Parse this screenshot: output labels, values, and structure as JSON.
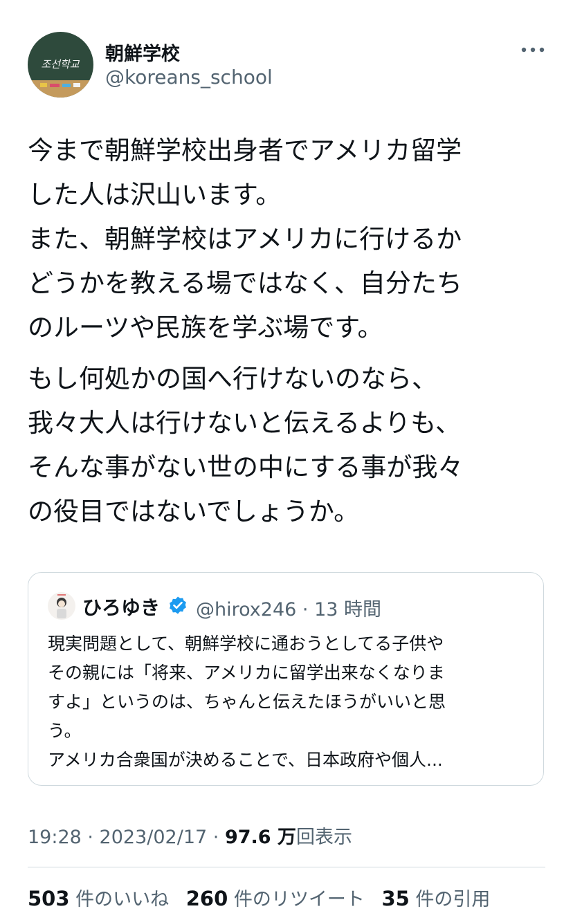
{
  "author": {
    "display_name": "朝鮮学校",
    "handle": "@koreans_school",
    "avatar_text": "조선학교"
  },
  "tweet": {
    "paragraphs": [
      [
        "今まで朝鮮学校出身者でアメリカ留学",
        "した人は沢山います。",
        "また、朝鮮学校はアメリカに行けるか",
        "どうかを教える場ではなく、自分たち",
        "のルーツや民族を学ぶ場です。"
      ],
      [
        "もし何処かの国へ行けないのなら、",
        "我々大人は行けないと伝えるよりも、",
        "そんな事がない世の中にする事が我々",
        "の役目ではないでしょうか。"
      ]
    ]
  },
  "quote": {
    "name": "ひろゆき",
    "handle_time": "@hirox246 · 13 時間",
    "lines": [
      "現実問題として、朝鮮学校に通おうとしてる子供や",
      "その親には「将来、アメリカに留学出来なくなりま",
      "すよ」というのは、ちゃんと伝えたほうがいいと思",
      "う。",
      "アメリカ合衆国が決めることで、日本政府や個人..."
    ]
  },
  "meta": {
    "time": "19:28 · 2023/02/17 · ",
    "views_count": "97.6 万",
    "views_label": "回表示"
  },
  "stats": {
    "likes_count": "503",
    "likes_label": " 件のいいね",
    "retweets_count": "260",
    "retweets_label": " 件のリツイート",
    "quotes_count": "35",
    "quotes_label": " 件の引用"
  },
  "colors": {
    "text": "#0f1419",
    "secondary": "#536471",
    "border": "#cfd9de",
    "verified": "#1d9bf0",
    "chalkboard": "#2e4a3c"
  },
  "icons": {
    "more": "more-icon",
    "verified": "verified-badge-icon"
  }
}
